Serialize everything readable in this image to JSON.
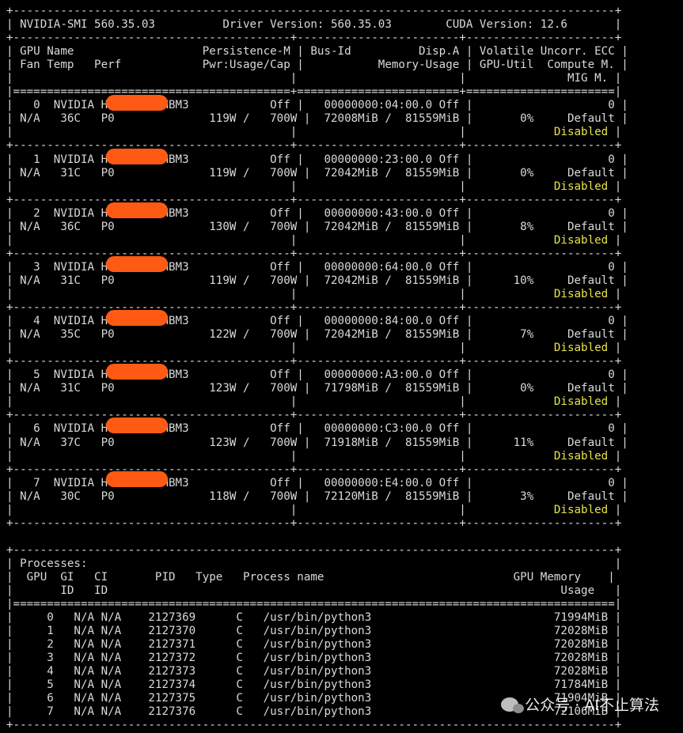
{
  "header": {
    "smi": "NVIDIA-SMI 560.35.03",
    "driver": "Driver Version: 560.35.03",
    "cuda": "CUDA Version: 12.6"
  },
  "columns": {
    "line1": {
      "gpu": "GPU",
      "name": "Name",
      "persistence": "Persistence-M",
      "busid": "Bus-Id",
      "dispa": "Disp.A",
      "ecc": "Volatile Uncorr. ECC"
    },
    "line2": {
      "fan": "Fan",
      "temp": "Temp",
      "perf": "Perf",
      "pwr": "Pwr:Usage/Cap",
      "mem": "Memory-Usage",
      "util": "GPU-Util",
      "compute": "Compute M."
    },
    "line3": {
      "mig": "MIG M."
    }
  },
  "gpus": [
    {
      "idx": "0",
      "name": "NVIDIA H",
      "model": "HBM3",
      "persist": "Off",
      "fan": "N/A",
      "temp": "36C",
      "perf": "P0",
      "pwr": "119W",
      "cap": "700W",
      "bus": "00000000:04:00.0",
      "disp": "Off",
      "mem_used": "72008MiB",
      "mem_total": "81559MiB",
      "util": "0%",
      "ecc": "0",
      "compute": "Default",
      "mig": "Disabled"
    },
    {
      "idx": "1",
      "name": "NVIDIA H",
      "model": "HBM3",
      "persist": "Off",
      "fan": "N/A",
      "temp": "31C",
      "perf": "P0",
      "pwr": "119W",
      "cap": "700W",
      "bus": "00000000:23:00.0",
      "disp": "Off",
      "mem_used": "72042MiB",
      "mem_total": "81559MiB",
      "util": "0%",
      "ecc": "0",
      "compute": "Default",
      "mig": "Disabled"
    },
    {
      "idx": "2",
      "name": "NVIDIA H",
      "model": "HBM3",
      "persist": "Off",
      "fan": "N/A",
      "temp": "36C",
      "perf": "P0",
      "pwr": "130W",
      "cap": "700W",
      "bus": "00000000:43:00.0",
      "disp": "Off",
      "mem_used": "72042MiB",
      "mem_total": "81559MiB",
      "util": "8%",
      "ecc": "0",
      "compute": "Default",
      "mig": "Disabled"
    },
    {
      "idx": "3",
      "name": "NVIDIA H",
      "model": "HBM3",
      "persist": "Off",
      "fan": "N/A",
      "temp": "31C",
      "perf": "P0",
      "pwr": "119W",
      "cap": "700W",
      "bus": "00000000:64:00.0",
      "disp": "Off",
      "mem_used": "72042MiB",
      "mem_total": "81559MiB",
      "util": "10%",
      "ecc": "0",
      "compute": "Default",
      "mig": "Disabled"
    },
    {
      "idx": "4",
      "name": "NVIDIA H",
      "model": "HBM3",
      "persist": "Off",
      "fan": "N/A",
      "temp": "35C",
      "perf": "P0",
      "pwr": "122W",
      "cap": "700W",
      "bus": "00000000:84:00.0",
      "disp": "Off",
      "mem_used": "72042MiB",
      "mem_total": "81559MiB",
      "util": "7%",
      "ecc": "0",
      "compute": "Default",
      "mig": "Disabled"
    },
    {
      "idx": "5",
      "name": "NVIDIA H",
      "model": "HBM3",
      "persist": "Off",
      "fan": "N/A",
      "temp": "31C",
      "perf": "P0",
      "pwr": "123W",
      "cap": "700W",
      "bus": "00000000:A3:00.0",
      "disp": "Off",
      "mem_used": "71798MiB",
      "mem_total": "81559MiB",
      "util": "0%",
      "ecc": "0",
      "compute": "Default",
      "mig": "Disabled"
    },
    {
      "idx": "6",
      "name": "NVIDIA H",
      "model": "HBM3",
      "persist": "Off",
      "fan": "N/A",
      "temp": "37C",
      "perf": "P0",
      "pwr": "123W",
      "cap": "700W",
      "bus": "00000000:C3:00.0",
      "disp": "Off",
      "mem_used": "71918MiB",
      "mem_total": "81559MiB",
      "util": "11%",
      "ecc": "0",
      "compute": "Default",
      "mig": "Disabled"
    },
    {
      "idx": "7",
      "name": "NVIDIA H",
      "model": "HBM3",
      "persist": "Off",
      "fan": "N/A",
      "temp": "30C",
      "perf": "P0",
      "pwr": "118W",
      "cap": "700W",
      "bus": "00000000:E4:00.0",
      "disp": "Off",
      "mem_used": "72120MiB",
      "mem_total": "81559MiB",
      "util": "3%",
      "ecc": "0",
      "compute": "Default",
      "mig": "Disabled"
    }
  ],
  "processes": {
    "title": "Processes:",
    "hdr1": {
      "gpu": "GPU",
      "gi": "GI",
      "ci": "CI",
      "pid": "PID",
      "type": "Type",
      "pname": "Process name",
      "gpumem": "GPU Memory"
    },
    "hdr2": {
      "gi": "ID",
      "ci": "ID",
      "usage": "Usage"
    },
    "rows": [
      {
        "gpu": "0",
        "gi": "N/A",
        "ci": "N/A",
        "pid": "2127369",
        "type": "C",
        "name": "/usr/bin/python3",
        "mem": "71994MiB"
      },
      {
        "gpu": "1",
        "gi": "N/A",
        "ci": "N/A",
        "pid": "2127370",
        "type": "C",
        "name": "/usr/bin/python3",
        "mem": "72028MiB"
      },
      {
        "gpu": "2",
        "gi": "N/A",
        "ci": "N/A",
        "pid": "2127371",
        "type": "C",
        "name": "/usr/bin/python3",
        "mem": "72028MiB"
      },
      {
        "gpu": "3",
        "gi": "N/A",
        "ci": "N/A",
        "pid": "2127372",
        "type": "C",
        "name": "/usr/bin/python3",
        "mem": "72028MiB"
      },
      {
        "gpu": "4",
        "gi": "N/A",
        "ci": "N/A",
        "pid": "2127373",
        "type": "C",
        "name": "/usr/bin/python3",
        "mem": "72028MiB"
      },
      {
        "gpu": "5",
        "gi": "N/A",
        "ci": "N/A",
        "pid": "2127374",
        "type": "C",
        "name": "/usr/bin/python3",
        "mem": "71784MiB"
      },
      {
        "gpu": "6",
        "gi": "N/A",
        "ci": "N/A",
        "pid": "2127375",
        "type": "C",
        "name": "/usr/bin/python3",
        "mem": "71904MiB"
      },
      {
        "gpu": "7",
        "gi": "N/A",
        "ci": "N/A",
        "pid": "2127376",
        "type": "C",
        "name": "/usr/bin/python3",
        "mem": "72106MiB"
      }
    ]
  },
  "watermark": {
    "text": "公众号 · AI不止算法",
    "icon": "wechat-icon"
  },
  "colors": {
    "background": "#000000",
    "text": "#d9d9d9",
    "mig_highlight": "#e6e34a",
    "redaction": "#ff5a14"
  }
}
